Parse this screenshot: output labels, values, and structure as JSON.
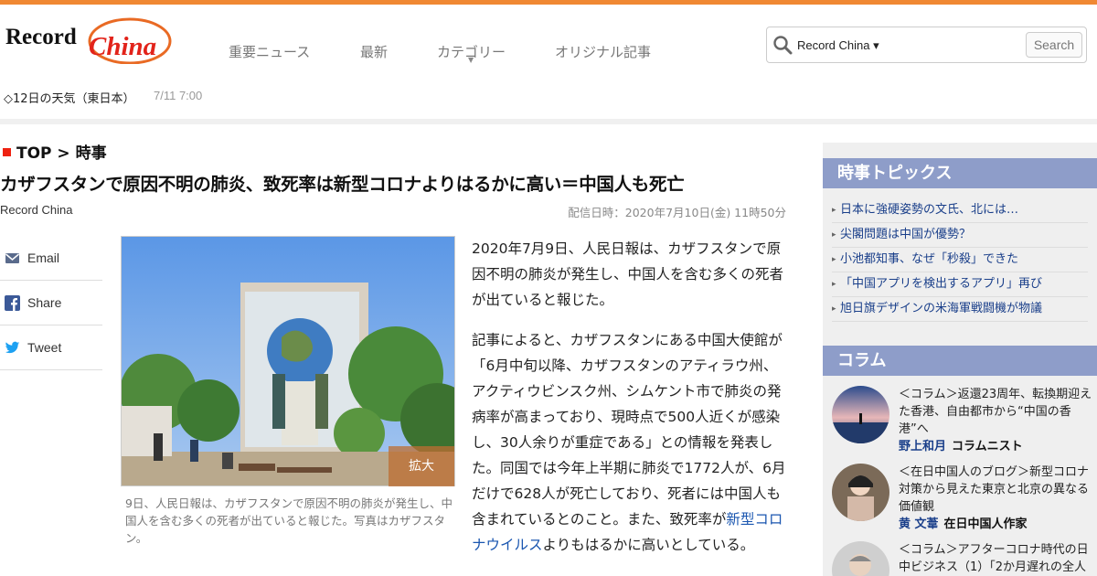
{
  "header": {
    "logo_text": "Record China",
    "nav": [
      "重要ニュース",
      "最新",
      "カテゴリー",
      "オリジナル記事"
    ],
    "search": {
      "scope": "Record China ▾",
      "button": "Search"
    },
    "ticker": {
      "text": "◇12日の天気（東日本）",
      "time": "7/11 7:00"
    }
  },
  "breadcrumb": {
    "top": "TOP",
    "sep": " > ",
    "section": "時事"
  },
  "article": {
    "title": "カザフスタンで原因不明の肺炎、致死率は新型コロナよりはるかに高い＝中国人も死亡",
    "source": "Record China",
    "published": "配信日時：2020年7月10日(金) 11時50分",
    "image_zoom_label": "拡大",
    "caption": "9日、人民日報は、カザフスタンで原因不明の肺炎が発生し、中国人を含む多くの死者が出ていると報じた。写真はカザフスタン。",
    "para1": "2020年7月9日、人民日報は、カザフスタンで原因不明の肺炎が発生し、中国人を含む多くの死者が出ていると報じた。",
    "para2_pre": "記事によると、カザフスタンにある中国大使館が「6月中旬以降、カザフスタンのアティラウ州、アクティウビンスク州、シムケント市で肺炎の発病率が高まっており、現時点で500人近くが感染し、30人余りが重症である」との情報を発表した。同国では今年上半期に肺炎で1772人が、6月だけで628人が死亡しており、死者には中国人も含まれているとのこと。また、致死率が",
    "para2_link": "新型コロナウイルス",
    "para2_post": "よりもはるかに高いとしている。"
  },
  "share": [
    {
      "label": "Email",
      "icon": "email-icon"
    },
    {
      "label": "Share",
      "icon": "facebook-icon"
    },
    {
      "label": "Tweet",
      "icon": "twitter-icon"
    }
  ],
  "sidebar": {
    "topics_title": "時事トピックス",
    "topics": [
      "日本に強硬姿勢の文氏、北には…",
      "尖閣問題は中国が優勢？",
      "小池都知事、なぜ「秒殺」できた",
      "「中国アプリを検出するアプリ」再び",
      "旭日旗デザインの米海軍戦闘機が物議"
    ],
    "column_title": "コラム",
    "columns": [
      {
        "title": "＜コラム＞返還23周年、転換期迎えた香港、自由都市から“中国の香港”へ",
        "author": "野上和月",
        "role": "コラムニスト"
      },
      {
        "title": "＜在日中国人のブログ＞新型コロナ対策から見えた東京と北京の異なる価値観",
        "author": "黄 文葦",
        "role": "在日中国人作家"
      },
      {
        "title": "＜コラム＞アフターコロナ時代の日中ビジネス（1）「2か月遅れの全人",
        "author": "",
        "role": ""
      }
    ]
  },
  "colors": {
    "accent_orange": "#f08833",
    "sidebar_header": "#8e9dc9",
    "link_blue": "#1a56b0"
  }
}
